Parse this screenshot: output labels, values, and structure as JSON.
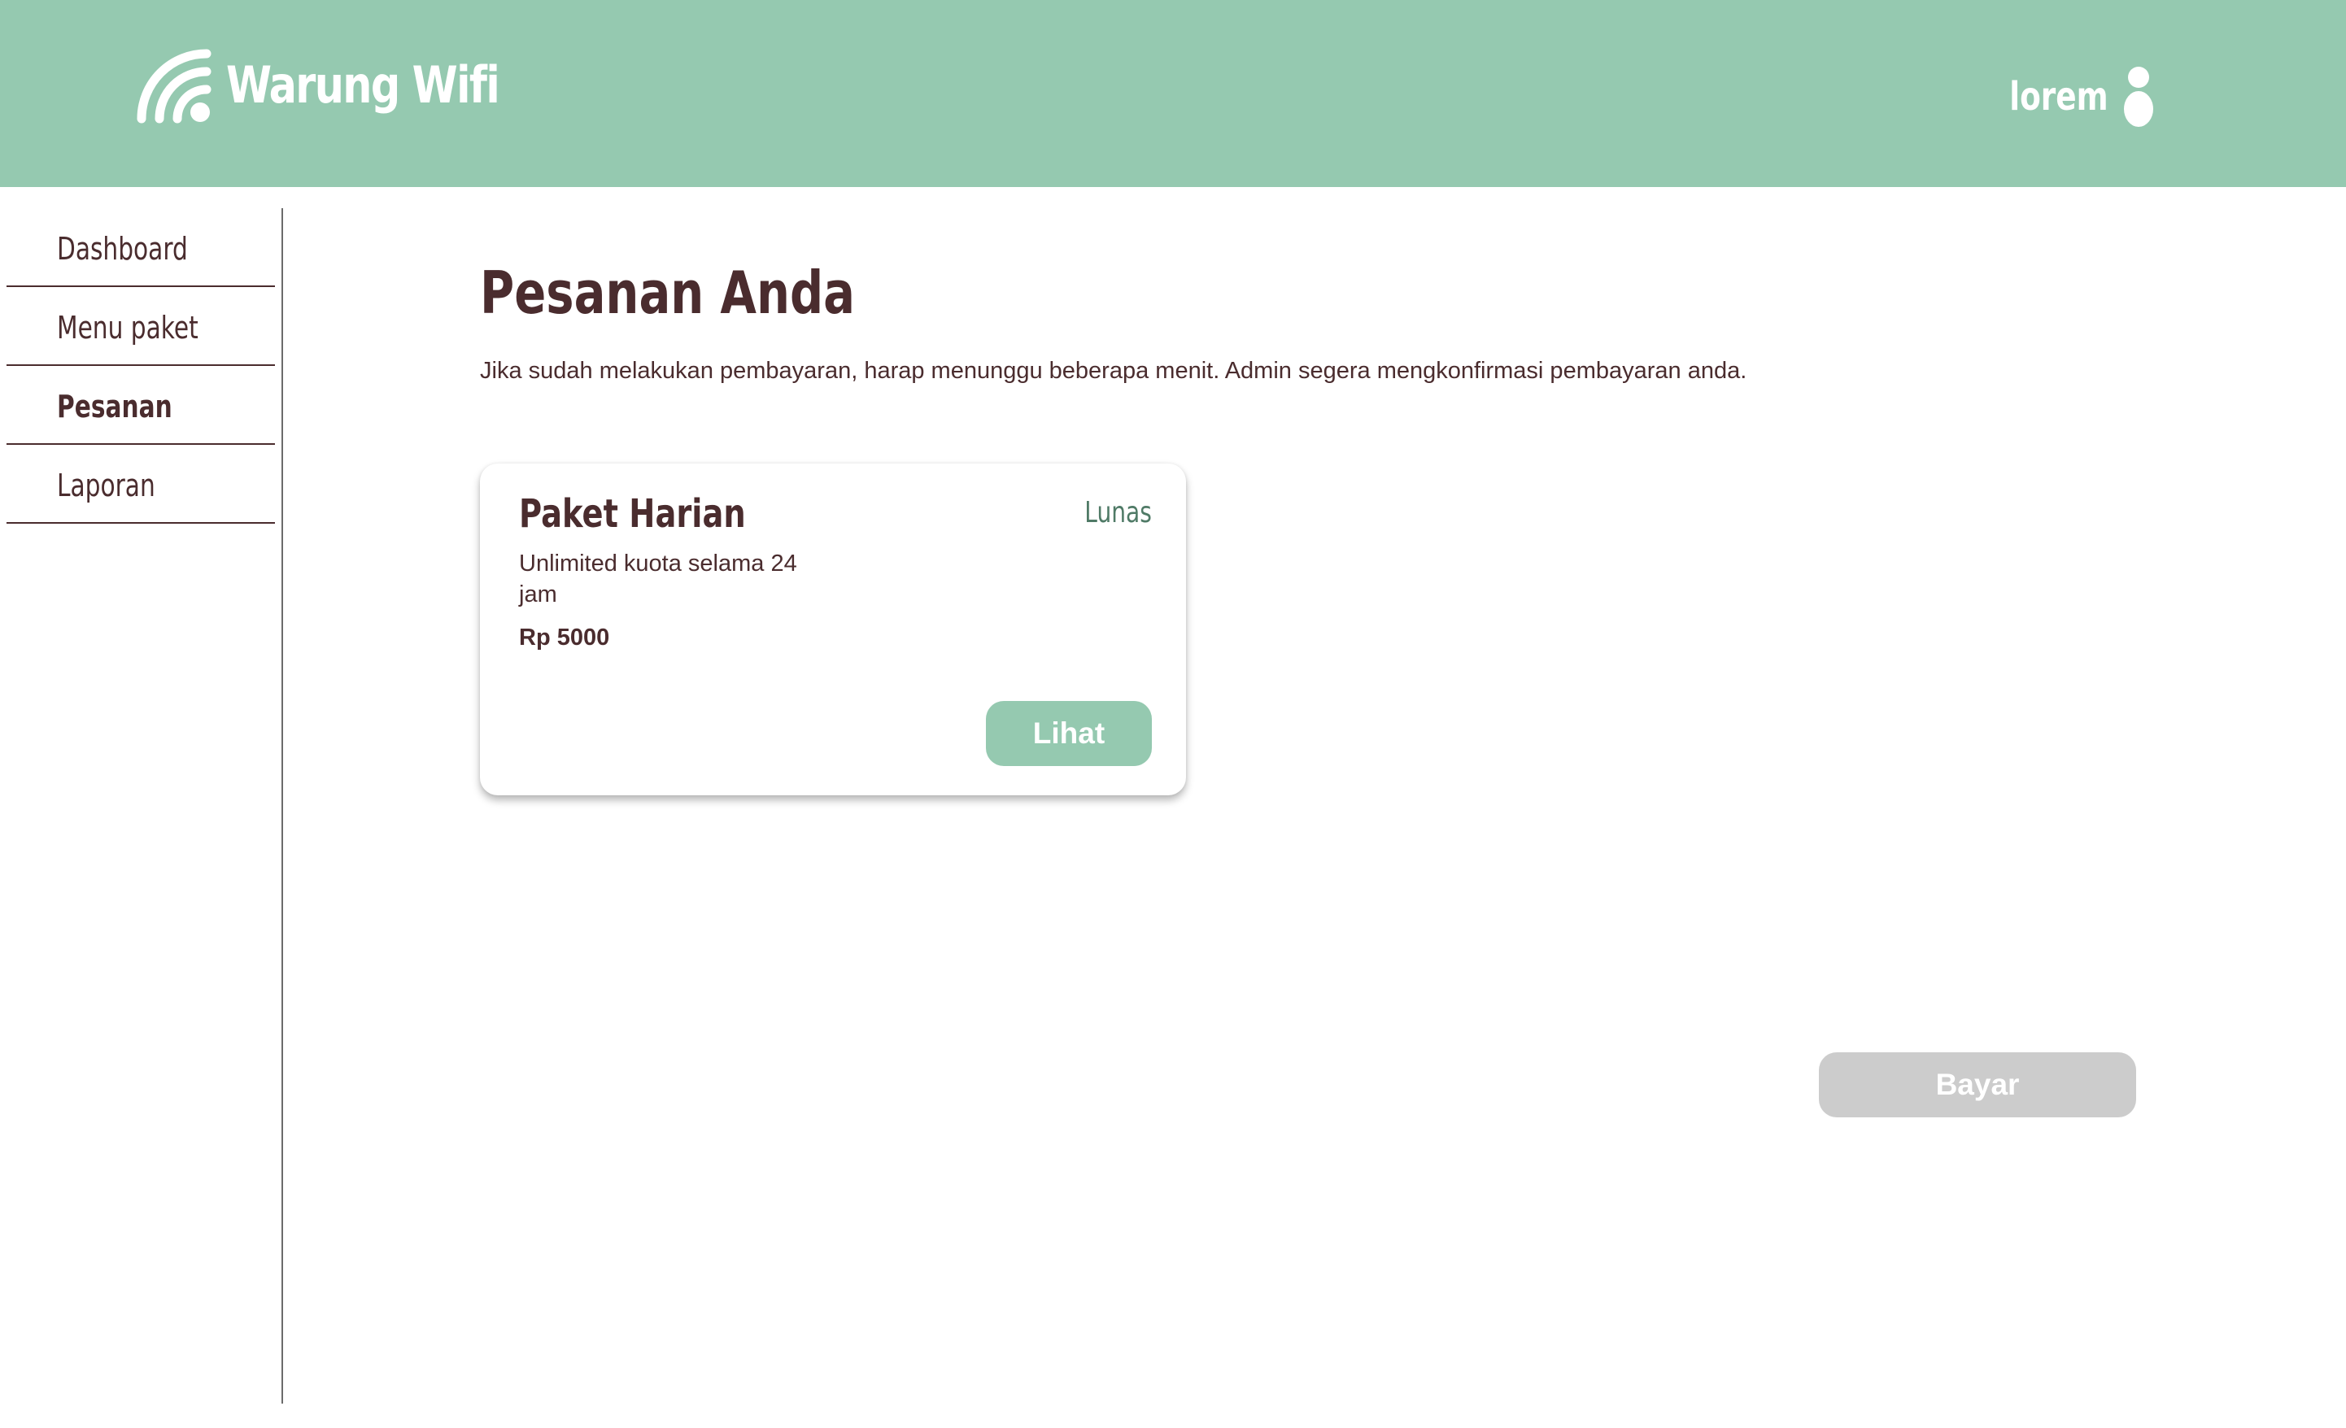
{
  "app": {
    "title": "Warung Wifi",
    "brand_color": "#95c9b0",
    "text_color": "#4a2c2e",
    "logo_icon": "wifi-icon"
  },
  "header": {
    "user_name": "lorem",
    "user_icon": "user-icon"
  },
  "sidebar": {
    "items": [
      {
        "label": "Dashboard",
        "active": false
      },
      {
        "label": "Menu paket",
        "active": false
      },
      {
        "label": "Pesanan",
        "active": true
      },
      {
        "label": "Laporan",
        "active": false
      }
    ]
  },
  "main": {
    "title": "Pesanan Anda",
    "subtitle": "Jika sudah melakukan pembayaran, harap menunggu beberapa menit. Admin segera mengkonfirmasi pembayaran anda.",
    "orders": [
      {
        "name": "Paket Harian",
        "status": "Lunas",
        "status_color": "#4f7a66",
        "description": "Unlimited kuota selama 24 jam",
        "price": "Rp 5000",
        "action_label": "Lihat"
      }
    ],
    "pay_button": {
      "label": "Bayar",
      "color": "#cccccc"
    }
  }
}
